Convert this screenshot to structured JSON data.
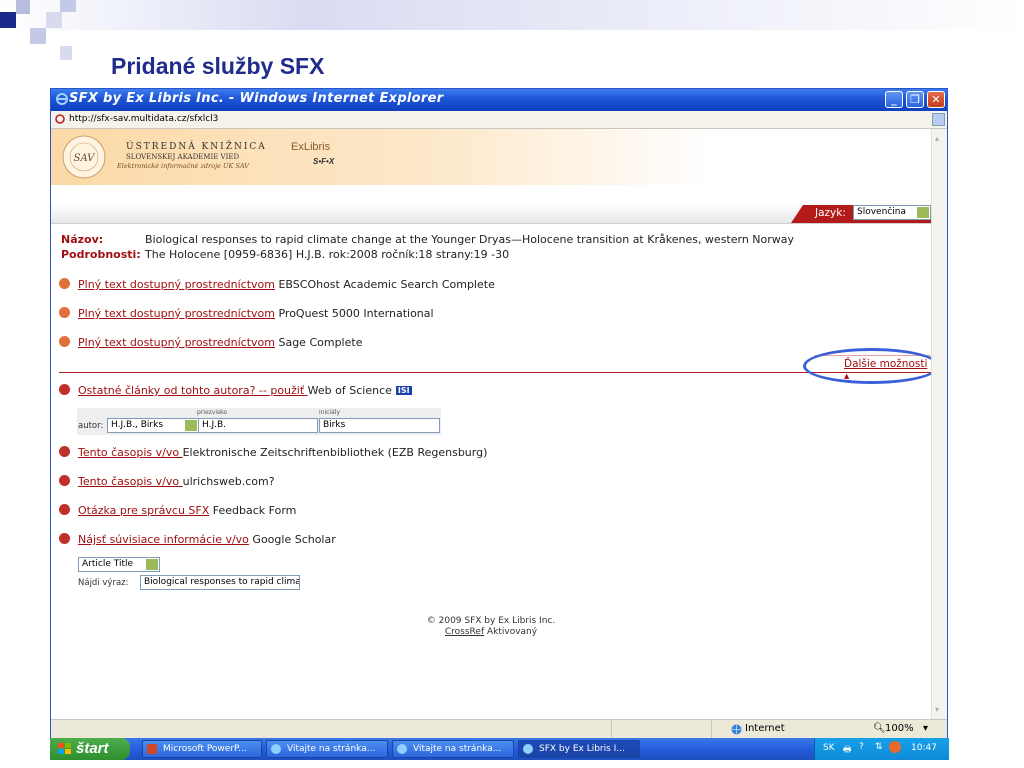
{
  "slide": {
    "title": "Pridané služby SFX"
  },
  "window": {
    "title": "SFX by Ex Libris Inc. - Windows Internet Explorer",
    "url": "http://sfx-sav.multidata.cz/sfxlcl3"
  },
  "banner": {
    "seal_text": "SAV",
    "library_line1": "ÚSTREDNÁ KNIŽNICA",
    "library_line2": "SLOVENSKEJ AKADEMIE VIED",
    "library_line3": "Elektronické informačné zdroje ÚK SAV",
    "exlibris_logo": "ExLibris",
    "sfx_logo": "S•F•X"
  },
  "language": {
    "label": "Jazyk:",
    "value": "Slovenčina"
  },
  "record": {
    "title_label": "Názov:",
    "title": "Biological responses to rapid climate change at the Younger Dryas—Holocene transition at Kråkenes, western Norway",
    "details_label": "Podrobnosti:",
    "details": "The Holocene [0959-6836] H.J.B. rok:2008 ročník:18 strany:19 -30"
  },
  "fulltext": [
    {
      "link": "Plný text dostupný prostredníctvom",
      "target": " EBSCOhost Academic Search Complete"
    },
    {
      "link": "Plný text dostupný prostredníctvom",
      "target": " ProQuest 5000 International"
    },
    {
      "link": "Plný text dostupný prostredníctvom",
      "target": " Sage Complete"
    }
  ],
  "more_options": "Ďalšie možnosti",
  "author_search": {
    "link": "Ostatné články od tohto autora? -- použiť ",
    "target": "Web of Science",
    "isi_badge": "ISI",
    "surname_label": "priezvisko",
    "initials_label": "iniciály",
    "author_label": "autor:",
    "author_select": "H.J.B., Birks",
    "surname_value": "H.J.B.",
    "initials_value": "Birks"
  },
  "services": [
    {
      "link": "Tento časopis v/vo ",
      "target": "Elektronische Zeitschriftenbibliothek (EZB Regensburg)",
      "color": "#c0302a"
    },
    {
      "link": "Tento časopis v/vo ",
      "target": "ulrichsweb.com?",
      "color": "#c0302a"
    },
    {
      "link": "Otázka pre správcu SFX",
      "target": " Feedback Form",
      "color": "#c0302a"
    },
    {
      "link": "Nájsť súvisiace informácie v/vo",
      "target": " Google Scholar",
      "color": "#c0302a"
    }
  ],
  "scholar": {
    "field_select": "Article Title",
    "find_label": "Nájdi výraz:",
    "find_value": "Biological responses to rapid clima"
  },
  "footer": {
    "copyright": "© 2009 SFX by Ex Libris Inc.",
    "crossref_link": "CrossRef",
    "crossref_status": " Aktivovaný"
  },
  "statusbar": {
    "zone": "Internet",
    "zoom": "100%"
  },
  "taskbar": {
    "start": "štart",
    "tasks": [
      "Microsoft PowerP...",
      "Vitajte na stránka...",
      "Vitajte na stránka...",
      "SFX by Ex Libris I..."
    ],
    "lang": "SK",
    "clock": "10:47"
  }
}
